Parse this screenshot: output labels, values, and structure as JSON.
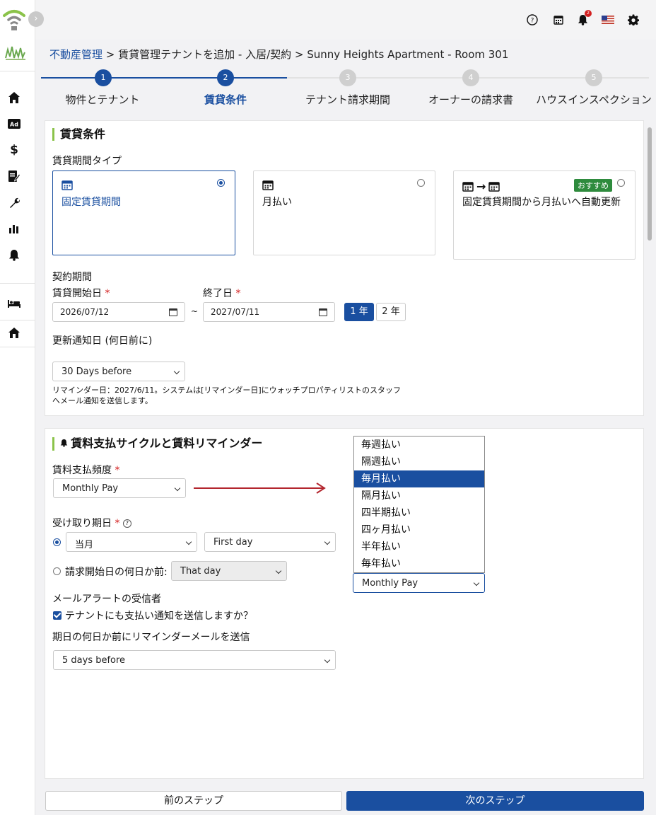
{
  "topbar": {
    "icons": [
      "help-icon",
      "calendar-icon",
      "bell-icon",
      "us-flag-icon",
      "gear-icon"
    ],
    "notification_count": "2"
  },
  "sidebar": {
    "icons": [
      "home-icon",
      "ad-icon",
      "dollar-icon",
      "contract-icon",
      "wrench-icon",
      "bar-chart-icon",
      "bell-icon",
      "bed-icon",
      "house-icon"
    ]
  },
  "breadcrumb": {
    "root": "不動産管理",
    "rest": " > 賃貸管理テナントを追加 - 入居/契約 > Sunny Heights Apartment - Room 301"
  },
  "steps": [
    {
      "number": "1",
      "label": "物件とテナント"
    },
    {
      "number": "2",
      "label": "賃貸条件"
    },
    {
      "number": "3",
      "label": "テナント請求期間"
    },
    {
      "number": "4",
      "label": "オーナーの請求書"
    },
    {
      "number": "5",
      "label": "ハウスインスペクション"
    }
  ],
  "rental": {
    "title": "賃貸条件",
    "period_type_label": "賃貸期間タイプ",
    "options": [
      {
        "label": "固定賃貸期間"
      },
      {
        "label": "月払い"
      },
      {
        "label": "固定賃貸期間から月払いへ自動更新",
        "badge": "おすすめ"
      }
    ],
    "contract_label": "契約期間",
    "start_label": "賃貸開始日",
    "end_label": "終了日",
    "start_value": "2026/07/12",
    "end_value": "2027/07/11",
    "tilde": "~",
    "year_buttons": [
      "1 年",
      "2 年"
    ],
    "renewal_label": "更新通知日 (何日前に)",
    "renewal_value": "30 Days before",
    "reminder_note_1": "リマインダー日：2027/6/11。システムは[リマインダー日]にウォッチプロパティリストのスタッフ",
    "reminder_note_2": "へメール通知を送信します。"
  },
  "payment": {
    "title": "賃料支払サイクルと賃料リマインダー",
    "freq_label": "賃料支払頻度",
    "freq_value": "Monthly Pay",
    "due_label": "受け取り期日",
    "month_value": "当月",
    "day_value": "First day",
    "before_label": "請求開始日の何日か前:",
    "before_value": "That day",
    "email_label": "メールアラートの受信者",
    "tenant_check_label": "テナントにも支払い通知を送信しますか？",
    "reminder_label": "期日の何日か前にリマインダーメールを送信",
    "reminder_value": "5 days before"
  },
  "dropdown": {
    "options": [
      "毎週払い",
      "隔週払い",
      "毎月払い",
      "隔月払い",
      "四半期払い",
      "四ヶ月払い",
      "半年払い",
      "毎年払い"
    ],
    "selected_index": 2,
    "select_value": "Monthly Pay"
  },
  "footer": {
    "prev": "前のステップ",
    "next": "次のステップ"
  },
  "colors": {
    "primary": "#1a4fa0",
    "accent_green": "#8bc34a",
    "badge_green": "#2e8b3d",
    "required_red": "#d32020",
    "arrow_red": "#b3262e"
  }
}
